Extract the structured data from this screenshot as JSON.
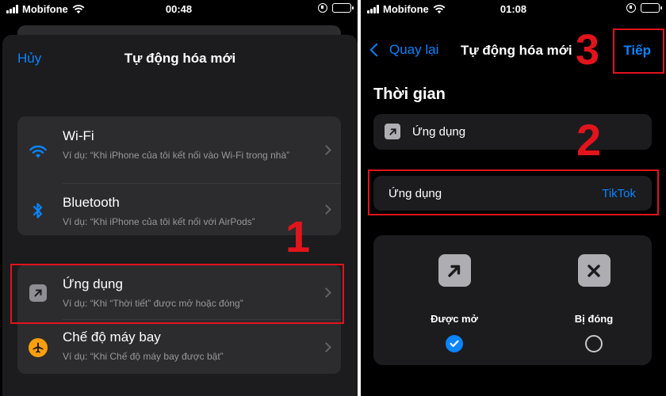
{
  "left": {
    "status": {
      "carrier": "Mobifone",
      "time": "00:48"
    },
    "nav": {
      "cancel": "Hủy",
      "title": "Tự động hóa mới"
    },
    "rows": [
      {
        "icon": "wifi-icon",
        "title": "Wi-Fi",
        "subtitle": "Ví dụ: “Khi iPhone của tôi kết nối vào Wi-Fi trong nhà”"
      },
      {
        "icon": "bluetooth-icon",
        "title": "Bluetooth",
        "subtitle": "Ví dụ: “Khi iPhone của tôi kết nối với AirPods”"
      },
      {
        "icon": "app-icon",
        "title": "Ứng dụng",
        "subtitle": "Ví dụ: “Khi “Thời tiết” được mở hoặc đóng”"
      },
      {
        "icon": "airplane-icon",
        "title": "Chế độ máy bay",
        "subtitle": "Ví dụ: “Khi Chế độ máy bay được bật”"
      }
    ],
    "step_number": "1"
  },
  "right": {
    "status": {
      "carrier": "Mobifone",
      "time": "01:08"
    },
    "nav": {
      "back": "Quay lại",
      "title": "Tự động hóa mới",
      "next": "Tiếp"
    },
    "section_title": "Thời gian",
    "app_row_label": "Ứng dụng",
    "selected_row": {
      "label": "Ứng dụng",
      "value": "TikTok"
    },
    "choices": [
      {
        "label": "Được mở",
        "icon": "arrow-up-right-icon",
        "selected": true
      },
      {
        "label": "Bị đóng",
        "icon": "close-icon",
        "selected": false
      }
    ],
    "step_numbers": [
      "2",
      "3"
    ]
  },
  "colors": {
    "accent": "#0a84ff",
    "highlight": "#e1141c",
    "battery": "#ffd60a",
    "airplane": "#ff9f0a"
  }
}
